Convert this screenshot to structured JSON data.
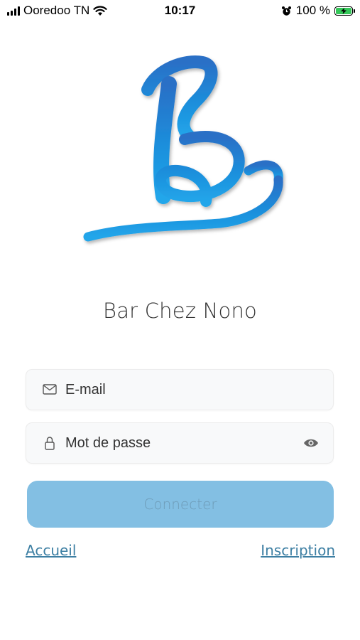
{
  "status_bar": {
    "carrier": "Ooredoo TN",
    "time": "10:17",
    "battery_percent": "100 %",
    "icons": [
      "signal-icon",
      "wifi-icon",
      "alarm-icon",
      "battery-charging-icon"
    ]
  },
  "app": {
    "title": "Bar Chez Nono",
    "brand_color": "#1f8fd8"
  },
  "form": {
    "email_placeholder": "E-mail",
    "email_value": "",
    "password_placeholder": "Mot de passe",
    "password_value": "",
    "connect_label": "Connecter",
    "connect_bg": "#83bfe3"
  },
  "links": {
    "home_label": "Accueil",
    "register_label": "Inscription"
  }
}
